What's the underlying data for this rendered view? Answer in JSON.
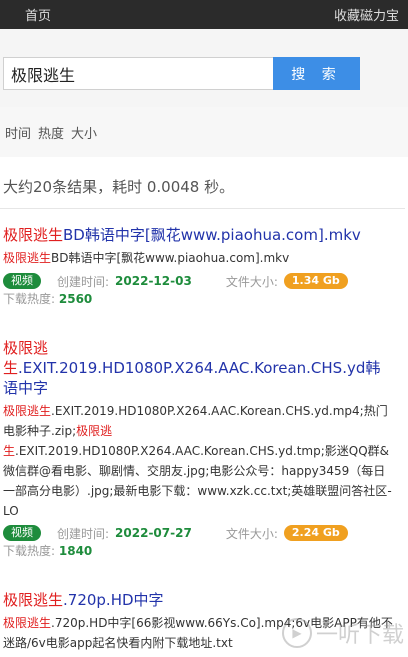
{
  "topbar": {
    "home": "首页",
    "bookmark": "收藏磁力宝"
  },
  "search": {
    "value": "极限逃生",
    "button": "搜 索"
  },
  "sort": [
    "时间",
    "热度",
    "大小"
  ],
  "summary": "大约20条结果，耗时 0.0048 秒。",
  "results": [
    {
      "title_hl": "极限逃生",
      "title_rest": "BD韩语中字[飘花www.piaohua.com].mkv",
      "desc_hl": "极限逃生",
      "desc_rest": "BD韩语中字[飘花www.piaohua.com].mkv",
      "tag": "视频",
      "created_label": "创建时间:",
      "created": "2022-12-03",
      "size_label": "文件大小:",
      "size": "1.34 Gb",
      "heat_label": "下载热度:",
      "heat": "2560"
    },
    {
      "title_hl": "极限逃生",
      "title_rest": ".EXIT.2019.HD1080P.X264.AAC.Korean.CHS.yd韩语中字",
      "desc_hl1": "极限逃生",
      "desc_rest1": ".EXIT.2019.HD1080P.X264.AAC.Korean.CHS.yd.mp4;热门电影种子.zip;",
      "desc_hl2": "极限逃生",
      "desc_rest2": ".EXIT.2019.HD1080P.X264.AAC.Korean.CHS.yd.tmp;影迷QQ群&微信群@看电影、聊剧情、交朋友.jpg;电影公众号：happy3459（每日一部高分电影）.jpg;最新电影下载：www.xzk.cc.txt;英雄联盟问答社区-LO",
      "tag": "视频",
      "created_label": "创建时间:",
      "created": "2022-07-27",
      "size_label": "文件大小:",
      "size": "2.24 Gb",
      "heat_label": "下载热度:",
      "heat": "1840"
    },
    {
      "title_hl": "极限逃生",
      "title_rest": ".720p.HD中字",
      "desc_hl": "极限逃生",
      "desc_rest": ".720p.HD中字[66影视www.66Ys.Co].mp4;6v电影APP有他不迷路/6v电影app起名快看内附下载地址.txt"
    }
  ],
  "watermark": "一听下载"
}
